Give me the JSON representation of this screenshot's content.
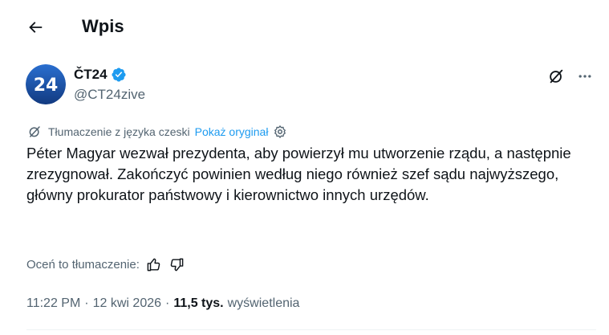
{
  "header": {
    "title": "Wpis",
    "back_icon": "arrow-left-icon"
  },
  "author": {
    "avatar_text": "24",
    "avatar_color": "#1a4fa0",
    "name": "ČT24",
    "verified": true,
    "verified_color": "#1d9bf0",
    "handle": "@CT24zive"
  },
  "translation": {
    "label": "Tłumaczenie z języka czeski",
    "show_original": "Pokaż oryginał"
  },
  "post": {
    "text": "Péter Magyar wezwał prezydenta, aby powierzył mu utworzenie rządu, a następnie zrezygnował. Zakończyć powinien według niego również szef sądu najwyższego, główny prokurator państwowy i kierownictwo innych urzędów."
  },
  "rating": {
    "label": "Oceń to tłumaczenie:"
  },
  "meta": {
    "time": "11:22 PM",
    "separator": "·",
    "date": "12 kwi 2026",
    "views_count": "11,5 tys.",
    "views_label": "wyświetlenia"
  },
  "colors": {
    "link": "#1d9bf0",
    "secondary_text": "#536471",
    "primary_text": "#0f1419"
  }
}
